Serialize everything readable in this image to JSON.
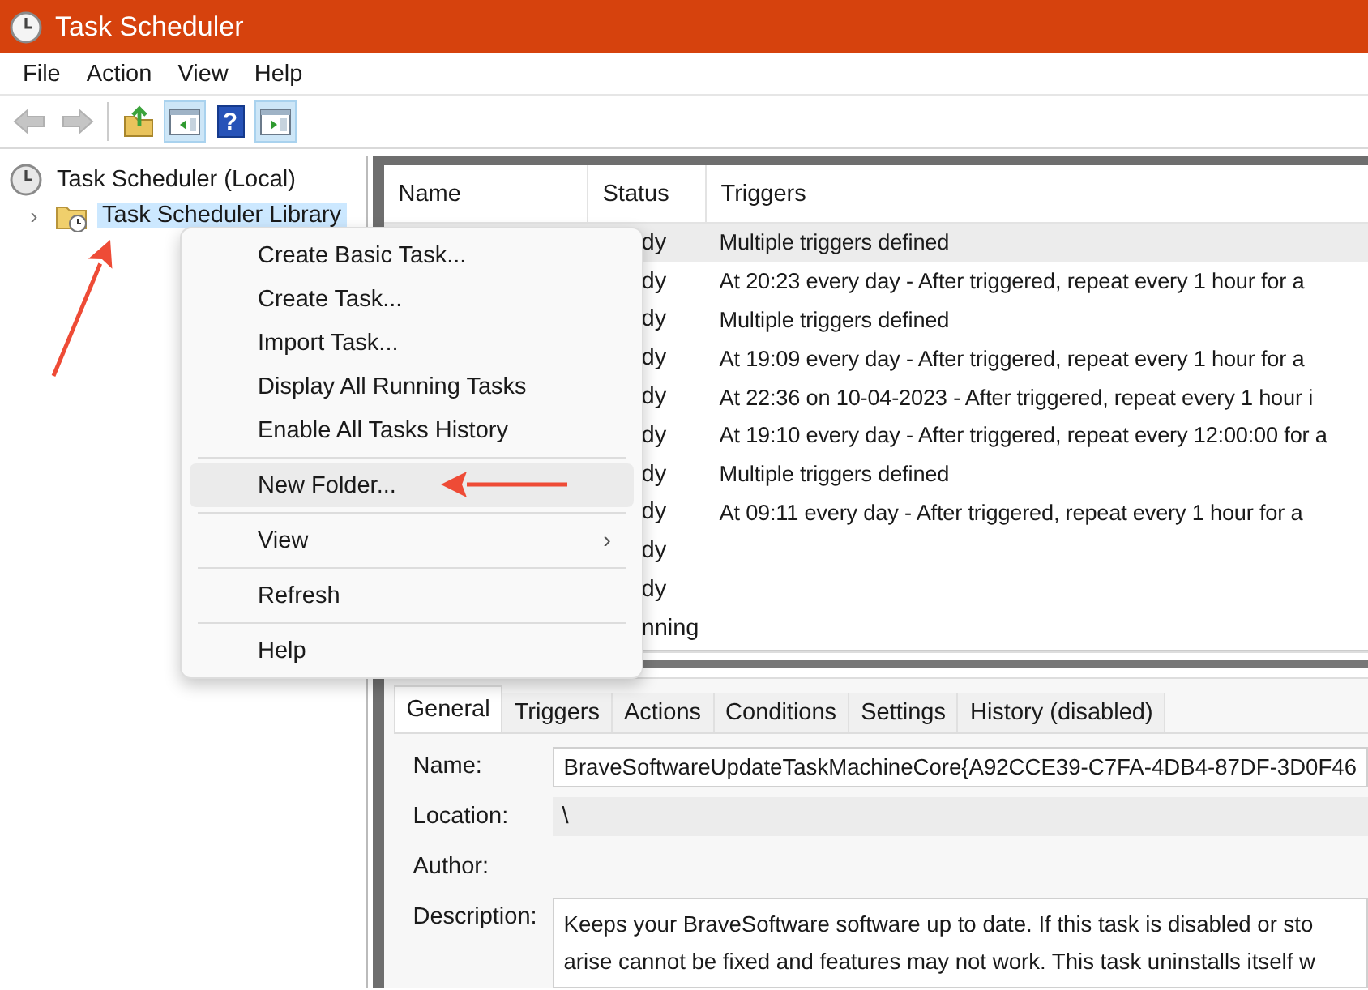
{
  "window": {
    "title": "Task Scheduler"
  },
  "menu_bar": [
    "File",
    "Action",
    "View",
    "Help"
  ],
  "toolbar": [
    {
      "kind": "back",
      "disabled": true,
      "pressed": false
    },
    {
      "kind": "forward",
      "disabled": true,
      "pressed": false
    },
    {
      "kind": "separator"
    },
    {
      "kind": "folder-up",
      "disabled": false,
      "pressed": false
    },
    {
      "kind": "tree-pane",
      "disabled": false,
      "pressed": true
    },
    {
      "kind": "help",
      "label": "?",
      "disabled": false,
      "pressed": false
    },
    {
      "kind": "action-pane",
      "disabled": false,
      "pressed": true
    }
  ],
  "tree": [
    {
      "label": "Task Scheduler (Local)",
      "selected": false,
      "children": [
        {
          "label": "Task Scheduler Library",
          "selected": true,
          "expander": "›"
        }
      ]
    }
  ],
  "table": {
    "columns": [
      "Name",
      "Status",
      "Triggers"
    ],
    "rows": [
      {
        "status": "dy",
        "triggers": "Multiple triggers defined",
        "selected": true
      },
      {
        "status": "dy",
        "triggers": "At 20:23 every day - After triggered, repeat every 1 hour for a",
        "selected": false
      },
      {
        "status": "dy",
        "triggers": "Multiple triggers defined",
        "selected": false
      },
      {
        "status": "dy",
        "triggers": "At 19:09 every day - After triggered, repeat every 1 hour for a",
        "selected": false
      },
      {
        "status": "dy",
        "triggers": "At 22:36 on 10-04-2023 - After triggered, repeat every 1 hour i",
        "selected": false
      },
      {
        "status": "dy",
        "triggers": "At 19:10 every day - After triggered, repeat every 12:00:00 for a",
        "selected": false
      },
      {
        "status": "dy",
        "triggers": "Multiple triggers defined",
        "selected": false
      },
      {
        "status": "dy",
        "triggers": "At 09:11 every day - After triggered, repeat every 1 hour for a",
        "selected": false
      },
      {
        "status": "dy",
        "selected": false
      },
      {
        "status": "dy",
        "selected": false
      },
      {
        "status": "nning",
        "selected": false
      }
    ]
  },
  "detail_tabs": [
    {
      "label": "General",
      "selected": true
    },
    {
      "label": "Triggers",
      "selected": false
    },
    {
      "label": "Actions",
      "selected": false
    },
    {
      "label": "Conditions",
      "selected": false
    },
    {
      "label": "Settings",
      "selected": false
    },
    {
      "label": "History (disabled)",
      "selected": false
    }
  ],
  "general": [
    {
      "kind": "field",
      "label": "Name:",
      "value": "BraveSoftwareUpdateTaskMachineCore{A92CCE39-C7FA-4DB4-87DF-3D0F46"
    },
    {
      "kind": "plain",
      "label": "Location:",
      "value": "\\"
    },
    {
      "kind": "plain",
      "label": "Author:"
    },
    {
      "kind": "textarea",
      "label": "Description:",
      "lines": [
        "Keeps your BraveSoftware software up to date. If this task is disabled or sto",
        "arise cannot be fixed and features may not work. This task uninstalls itself w"
      ]
    }
  ],
  "context_menu": [
    {
      "kind": "item",
      "label": "Create Basic Task...",
      "selected": false
    },
    {
      "kind": "item",
      "label": "Create Task...",
      "selected": false
    },
    {
      "kind": "item",
      "label": "Import Task...",
      "selected": false
    },
    {
      "kind": "item",
      "label": "Display All Running Tasks",
      "selected": false
    },
    {
      "kind": "item",
      "label": "Enable All Tasks History",
      "selected": false
    },
    {
      "kind": "separator"
    },
    {
      "kind": "item",
      "label": "New Folder...",
      "selected": true
    },
    {
      "kind": "separator"
    },
    {
      "kind": "submenu",
      "label": "View",
      "arrow": "›",
      "selected": false
    },
    {
      "kind": "separator"
    },
    {
      "kind": "item",
      "label": "Refresh",
      "selected": false
    },
    {
      "kind": "separator"
    },
    {
      "kind": "item",
      "label": "Help",
      "selected": false
    }
  ]
}
